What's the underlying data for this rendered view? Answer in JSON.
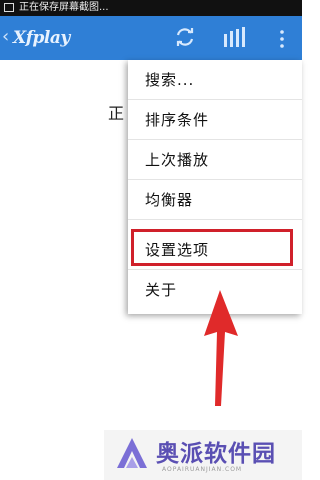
{
  "statusbar": {
    "text": "正在保存屏幕截图..."
  },
  "actionbar": {
    "back": "‹",
    "title": "Xfplay"
  },
  "background": {
    "partial_text": "正"
  },
  "menu": {
    "items": [
      {
        "label": "搜索..."
      },
      {
        "label": "排序条件"
      },
      {
        "label": "上次播放"
      },
      {
        "label": "均衡器"
      },
      {
        "label": "设置选项"
      },
      {
        "label": "关于"
      }
    ]
  },
  "annotation": {
    "highlight_color": "#d0202a",
    "arrow_color": "#e02a2a"
  },
  "watermark": {
    "text": "奥派软件园",
    "subtext": "AOPAIRUANJIAN.COM"
  },
  "colors": {
    "actionbar": "#2f7fd6"
  }
}
